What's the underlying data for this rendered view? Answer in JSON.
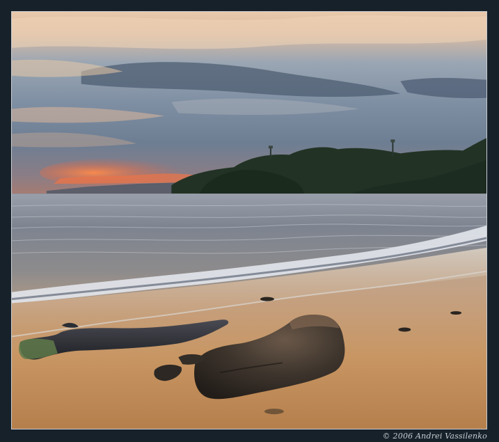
{
  "photo": {
    "subject": "",
    "colors": {
      "frame": "#17212a",
      "border": "#c9ccd0",
      "sky_top": "#e6c7a9",
      "sky_mid": "#8e9cac",
      "sunset_glow": "#e46a3a",
      "water": "#7f8490",
      "wave_foam": "#dde1e8",
      "sand": "#c99760",
      "rock": "#3a332c",
      "foliage": "#1b2a20"
    }
  },
  "copyright": "© 2006 Andrei Vassilenko"
}
